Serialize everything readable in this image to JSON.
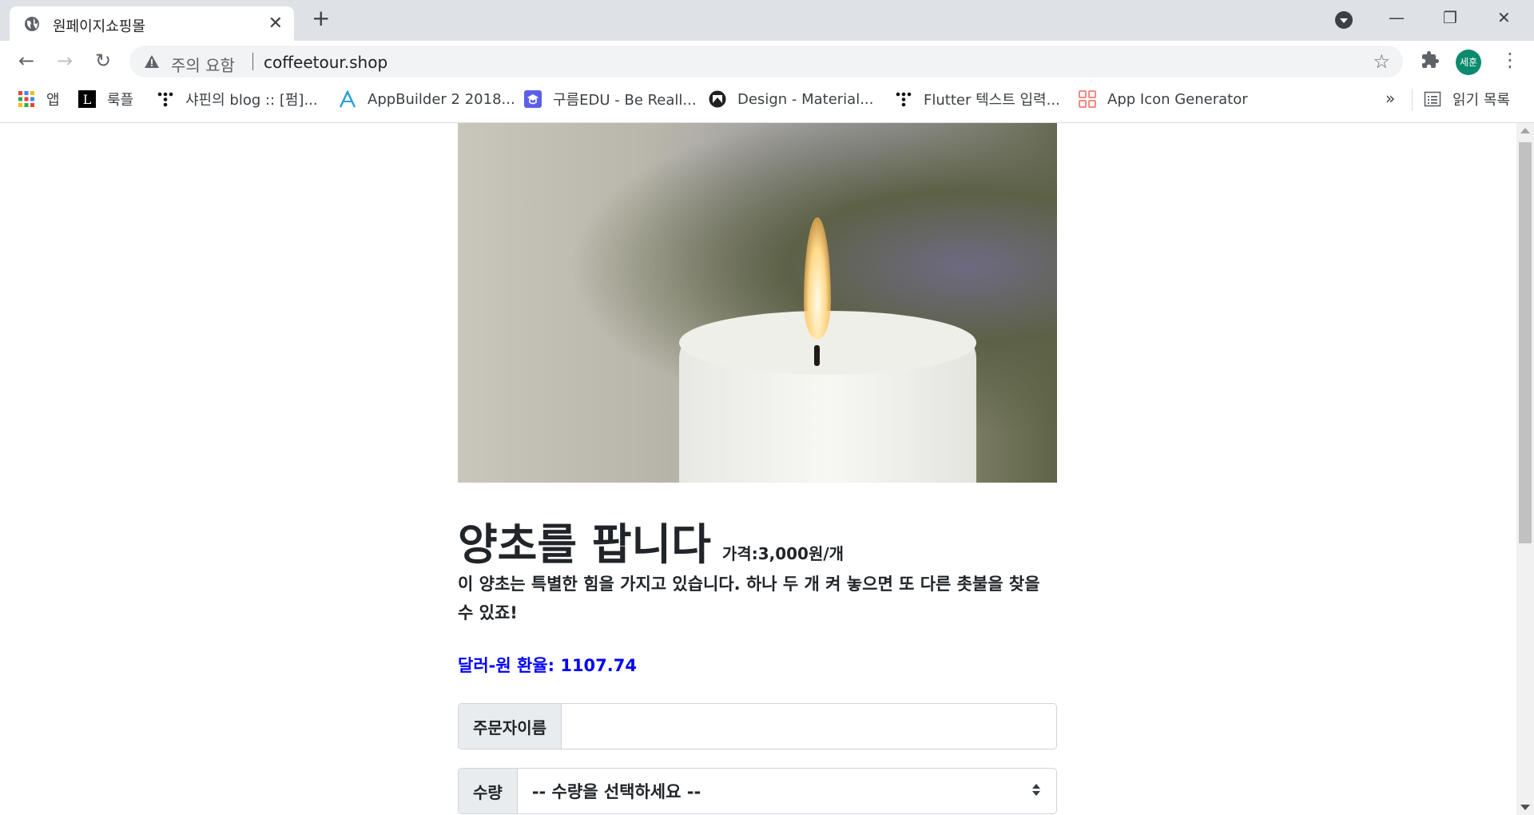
{
  "browser": {
    "tab_title": "원페이지쇼핑몰",
    "tab_close": "✕",
    "new_tab": "+",
    "security_warning": "주의 요함",
    "url": "coffeetour.shop",
    "profile_initials": "세훈",
    "window_buttons": {
      "minimize": "—",
      "restore": "❐",
      "close": "✕"
    },
    "nav": {
      "back": "←",
      "forward": "→",
      "reload": "↻"
    },
    "star": "☆",
    "menu": "⋮"
  },
  "bookmarks": {
    "items": [
      {
        "label": "앱",
        "icon": "apps-grid-icon"
      },
      {
        "label": "룩플",
        "icon": "l-logo-icon"
      },
      {
        "label": "샤핀의 blog :: [펌]...",
        "icon": "tistory-icon"
      },
      {
        "label": "AppBuilder 2 2018...",
        "icon": "appbuilder-icon"
      },
      {
        "label": "구름EDU - Be Reall...",
        "icon": "goorm-icon"
      },
      {
        "label": "Design - Material...",
        "icon": "material-icon"
      },
      {
        "label": "Flutter 텍스트 입력...",
        "icon": "tistory-icon"
      },
      {
        "label": "App Icon Generator",
        "icon": "app-icon-generator-icon"
      }
    ],
    "more": "»",
    "reading_list": "읽기 목록"
  },
  "product": {
    "title": "양초를 팝니다",
    "price": "가격:3,000원/개",
    "description": "이 양초는 특별한 힘을 가지고 있습니다. 하나 두 개 켜 놓으면 또 다른 촛불을 찾을 수 있죠!",
    "exchange_rate": "달러-원 환율: 1107.74"
  },
  "order_form": {
    "name_label": "주문자이름",
    "name_value": "",
    "quantity_label": "수량",
    "quantity_selected": "-- 수량을 선택하세요 --"
  },
  "colors": {
    "rate_text": "#0000ff",
    "avatar_bg": "#0b8a6e"
  }
}
